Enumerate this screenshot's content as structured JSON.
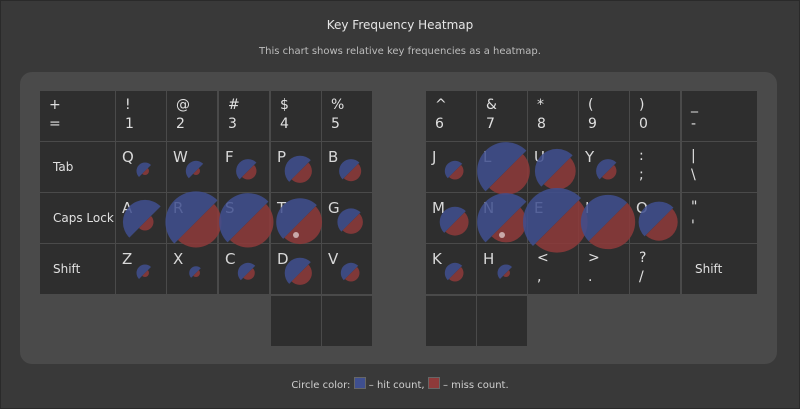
{
  "title": "Key Frequency Heatmap",
  "subtitle": "This chart shows relative key frequencies as a heatmap.",
  "legend": {
    "prefix": "Circle color:",
    "hit_label": "– hit count,",
    "miss_label": "– miss count."
  },
  "colors": {
    "hit": "#3f4f8f",
    "miss": "#8e3a3a",
    "key": "#2e2e2e",
    "panel": "#4a4a4a"
  },
  "keys": [
    {
      "id": "plus",
      "top": "+",
      "bottom": "="
    },
    {
      "id": "1",
      "top": "!",
      "bottom": "1"
    },
    {
      "id": "2",
      "top": "@",
      "bottom": "2"
    },
    {
      "id": "3",
      "top": "#",
      "bottom": "3"
    },
    {
      "id": "4",
      "top": "$",
      "bottom": "4"
    },
    {
      "id": "5",
      "top": "%",
      "bottom": "5"
    },
    {
      "id": "6",
      "top": "^",
      "bottom": "6"
    },
    {
      "id": "7",
      "top": "&",
      "bottom": "7"
    },
    {
      "id": "8",
      "top": "*",
      "bottom": "8"
    },
    {
      "id": "9",
      "top": "(",
      "bottom": "9"
    },
    {
      "id": "0",
      "top": ")",
      "bottom": "0"
    },
    {
      "id": "minus",
      "top": "_",
      "bottom": "-"
    },
    {
      "id": "tab",
      "label": "Tab"
    },
    {
      "id": "q",
      "letter": "Q"
    },
    {
      "id": "w",
      "letter": "W"
    },
    {
      "id": "f",
      "letter": "F"
    },
    {
      "id": "p",
      "letter": "P"
    },
    {
      "id": "b",
      "letter": "B"
    },
    {
      "id": "j",
      "letter": "J"
    },
    {
      "id": "l",
      "letter": "L"
    },
    {
      "id": "u",
      "letter": "U"
    },
    {
      "id": "y",
      "letter": "Y"
    },
    {
      "id": "semicolon",
      "top": ":",
      "bottom": ";"
    },
    {
      "id": "pipe",
      "top": "|",
      "bottom": "\\"
    },
    {
      "id": "caps",
      "label": "Caps Lock"
    },
    {
      "id": "a",
      "letter": "A"
    },
    {
      "id": "r",
      "letter": "R"
    },
    {
      "id": "s",
      "letter": "S"
    },
    {
      "id": "t",
      "letter": "T"
    },
    {
      "id": "g",
      "letter": "G"
    },
    {
      "id": "m",
      "letter": "M"
    },
    {
      "id": "n",
      "letter": "N"
    },
    {
      "id": "e",
      "letter": "E"
    },
    {
      "id": "i",
      "letter": "I"
    },
    {
      "id": "o",
      "letter": "O"
    },
    {
      "id": "quote",
      "top": "\"",
      "bottom": "'"
    },
    {
      "id": "lshift",
      "label": "Shift"
    },
    {
      "id": "z",
      "letter": "Z"
    },
    {
      "id": "x",
      "letter": "X"
    },
    {
      "id": "c",
      "letter": "C"
    },
    {
      "id": "d",
      "letter": "D"
    },
    {
      "id": "v",
      "letter": "V"
    },
    {
      "id": "k",
      "letter": "K"
    },
    {
      "id": "h",
      "letter": "H"
    },
    {
      "id": "comma",
      "top": "<",
      "bottom": ","
    },
    {
      "id": "period",
      "top": ">",
      "bottom": "."
    },
    {
      "id": "slash",
      "top": "?",
      "bottom": "/"
    },
    {
      "id": "rshift",
      "label": "Shift"
    },
    {
      "id": "thumb1"
    },
    {
      "id": "thumb2"
    },
    {
      "id": "thumb3"
    },
    {
      "id": "thumb4"
    }
  ],
  "frequencies": [
    {
      "key": "q",
      "hit": 0.25,
      "miss": 0.05
    },
    {
      "key": "w",
      "hit": 0.3,
      "miss": 0.05
    },
    {
      "key": "f",
      "hit": 0.35,
      "miss": 0.25
    },
    {
      "key": "p",
      "hit": 0.45,
      "miss": 0.35
    },
    {
      "key": "b",
      "hit": 0.35,
      "miss": 0.3
    },
    {
      "key": "j",
      "hit": 0.3,
      "miss": 0.25
    },
    {
      "key": "l",
      "hit": 0.85,
      "miss": 0.7
    },
    {
      "key": "u",
      "hit": 0.65,
      "miss": 0.55
    },
    {
      "key": "y",
      "hit": 0.35,
      "miss": 0.25
    },
    {
      "key": "a",
      "hit": 0.65,
      "miss": 0.25
    },
    {
      "key": "r",
      "hit": 0.9,
      "miss": 0.75
    },
    {
      "key": "s",
      "hit": 0.85,
      "miss": 0.75
    },
    {
      "key": "t",
      "hit": 0.7,
      "miss": 0.65
    },
    {
      "key": "g",
      "hit": 0.4,
      "miss": 0.35
    },
    {
      "key": "m",
      "hit": 0.45,
      "miss": 0.4
    },
    {
      "key": "n",
      "hit": 0.85,
      "miss": 0.6
    },
    {
      "key": "e",
      "hit": 1.0,
      "miss": 0.9
    },
    {
      "key": "i",
      "hit": 0.8,
      "miss": 0.8
    },
    {
      "key": "o",
      "hit": 0.6,
      "miss": 0.55
    },
    {
      "key": "z",
      "hit": 0.25,
      "miss": 0.05
    },
    {
      "key": "x",
      "hit": 0.2,
      "miss": 0.05
    },
    {
      "key": "c",
      "hit": 0.3,
      "miss": 0.2
    },
    {
      "key": "d",
      "hit": 0.45,
      "miss": 0.35
    },
    {
      "key": "v",
      "hit": 0.3,
      "miss": 0.25
    },
    {
      "key": "k",
      "hit": 0.3,
      "miss": 0.25
    },
    {
      "key": "h",
      "hit": 0.25,
      "miss": 0.05
    }
  ]
}
